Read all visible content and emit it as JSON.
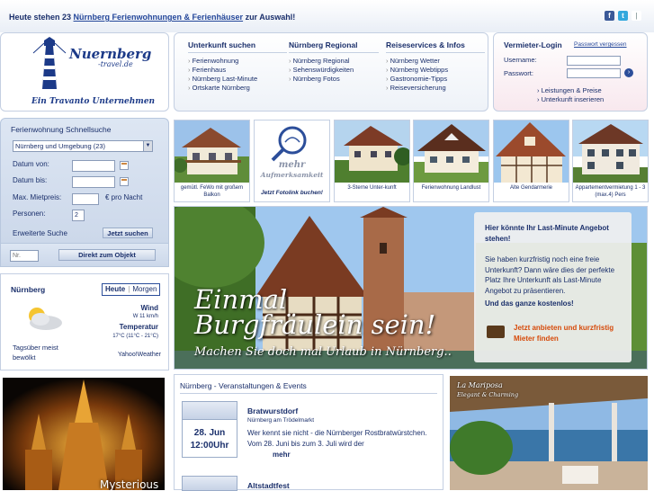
{
  "top": {
    "message_prefix": "Heute stehen 23 ",
    "message_link": "Nürnberg Ferienwohnungen & Ferienhäuser",
    "message_suffix": " zur Auswahl!",
    "social": [
      {
        "name": "facebook-icon",
        "glyph": "f",
        "color": "#3b5998"
      },
      {
        "name": "twitter-icon",
        "glyph": "t",
        "color": "#33a8dd"
      },
      {
        "name": "share-icon",
        "glyph": "|",
        "color": "#9aa"
      }
    ]
  },
  "logo": {
    "brand": "Nuernberg",
    "brand_sub": "-travel.de",
    "tagline": "Ein Travanto Unternehmen"
  },
  "nav": {
    "columns": [
      {
        "title": "Unterkunft suchen",
        "items": [
          "Ferienwohnung",
          "Ferienhaus",
          "Nürnberg Last-Minute",
          "Ortskarte Nürnberg"
        ]
      },
      {
        "title": "Nürnberg Regional",
        "items": [
          "Nürnberg Regional",
          "Sehenswürdigkeiten",
          "Nürnberg Fotos"
        ]
      },
      {
        "title": "Reiseservices & Infos",
        "items": [
          "Nürnberg Wetter",
          "Nürnberg Webtipps",
          "Gastronomie-Tipps",
          "Reiseversicherung"
        ]
      }
    ]
  },
  "login": {
    "title": "Vermieter-Login",
    "forgot": "Passwort vergessen",
    "username_label": "Username:",
    "password_label": "Passwort:",
    "links": [
      "Leistungen & Preise",
      "Unterkunft inserieren"
    ]
  },
  "search": {
    "title": "Ferienwohnung Schnellsuche",
    "region": "Nürnberg und Umgebung (23)",
    "date_from": "Datum von:",
    "date_to": "Datum bis:",
    "max_rent": "Max. Mietpreis:",
    "per_night": "€ pro Nacht",
    "persons": "Personen:",
    "persons_value": "2",
    "advanced": "Erweiterte Suche",
    "search_btn": "Jetzt suchen",
    "nr_placeholder": "Nr.",
    "direct_btn": "Direkt zum Objekt"
  },
  "weather": {
    "city": "Nürnberg",
    "tab_today": "Heute",
    "tab_tomorrow": "Morgen",
    "wind_label": "Wind",
    "wind_value": "W 11 km/h",
    "temp_label": "Temperatur",
    "temp_value": "17°C (11°C - 21°C)",
    "desc": "Tagsüber meist bewölkt",
    "source": "Yahoo!Weather"
  },
  "thumbs": [
    {
      "caption": "gemütl. FeWo mit großem Balkon"
    },
    {
      "caption": "mehr",
      "sub": "Aufmerksamkeit",
      "cta": "Jetzt Fotolink buchen!"
    },
    {
      "caption": "3-Sterne Unter-kunft"
    },
    {
      "caption": "Ferienwohnung Landlust"
    },
    {
      "caption": "Alte Gendarmerie"
    },
    {
      "caption": "Appartementvermietung 1 - 3 (max.4) Pers"
    }
  ],
  "hero": {
    "line1": "Einmal",
    "line2": "Burgfräulein sein!",
    "line3": "Machen Sie doch mal Urlaub in Nürnberg.."
  },
  "promo": {
    "title": "Hier könnte Ihr Last-Minute Angebot stehen!",
    "body": "Sie haben kurzfristig noch eine freie Unterkunft? Dann wäre dies der perfekte Platz Ihre Unterkunft als Last-Minute Angebot zu präsentieren.",
    "free": "Und das ganze kostenlos!",
    "cta": "Jetzt anbieten und kurzfristig Mieter finden"
  },
  "ad_left": {
    "text": "Mysterious"
  },
  "events": {
    "title": "Nürnberg - Veranstaltungen & Events",
    "items": [
      {
        "date": "28. Jun",
        "time": "12:00Uhr",
        "name": "Bratwurstdorf",
        "place": "Nürnberg am Trödelmarkt",
        "desc": "Wer kennt sie nicht - die Nürnberger Rostbratwürstchen. Vom 28. Juni bis zum 3. Juli wird der",
        "more": "mehr"
      },
      {
        "name": "Altstadtfest"
      }
    ]
  },
  "ad_right": {
    "brand": "La Mariposa",
    "tagline": "Elegant & Charming"
  }
}
